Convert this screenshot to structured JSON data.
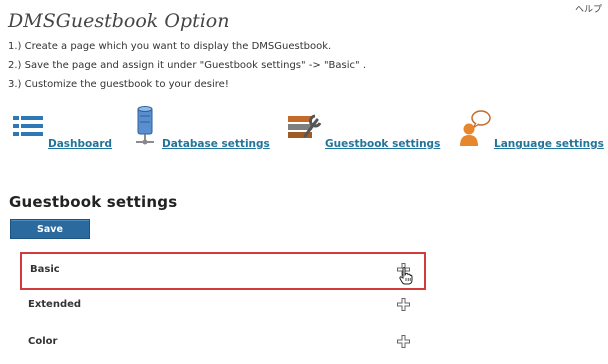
{
  "header": {
    "help_link": "ヘルプ",
    "title": "DMSGuestbook Option"
  },
  "instructions": [
    "1.) Create a page which you want to display the DMSGuestbook.",
    "2.) Save the page and assign it under \"Guestbook settings\" -> \"Basic\" .",
    "3.) Customize the guestbook to your desire!"
  ],
  "nav": [
    {
      "label": "Dashboard",
      "icon": "dashboard-list-icon"
    },
    {
      "label": "Database settings",
      "icon": "database-icon"
    },
    {
      "label": "Guestbook settings",
      "icon": "tools-icon"
    },
    {
      "label": "Language settings",
      "icon": "user-speech-bubble-icon"
    }
  ],
  "section": {
    "title": "Guestbook settings",
    "save_label": "Save"
  },
  "settings_rows": [
    {
      "label": "Basic",
      "highlighted": true
    },
    {
      "label": "Extended",
      "highlighted": false
    },
    {
      "label": "Color",
      "highlighted": false
    }
  ],
  "colors": {
    "link": "#21759b",
    "button": "#2a6a9e",
    "highlight_border": "#d23b3b"
  }
}
